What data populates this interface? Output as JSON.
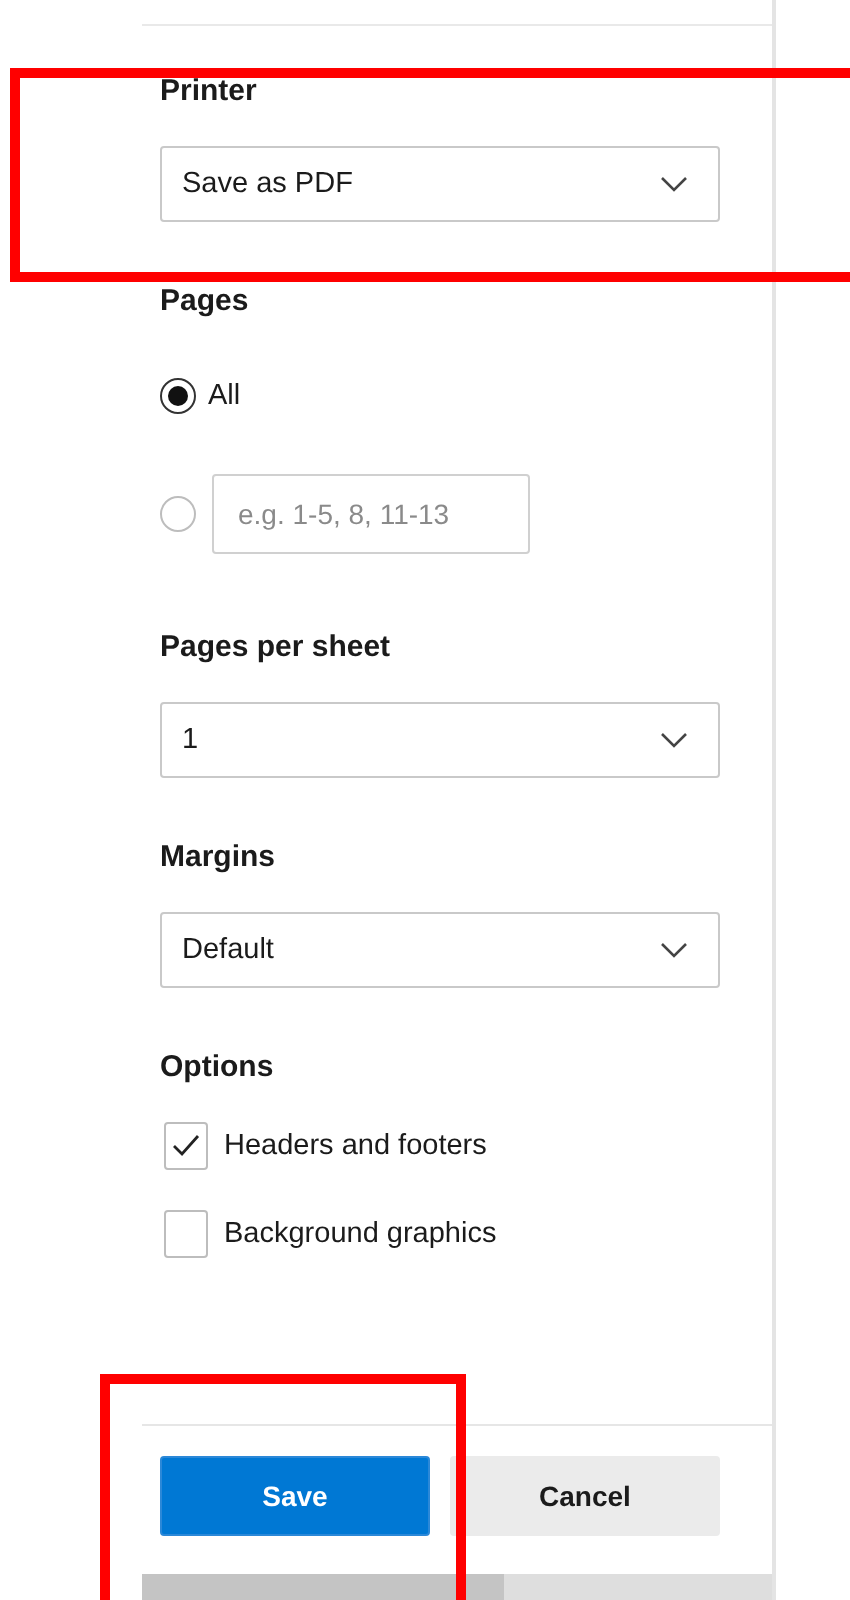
{
  "sections": [
    {
      "kind": "select",
      "title": "Printer",
      "value": "Save as PDF",
      "highlighted": true
    },
    {
      "kind": "radios",
      "title": "Pages",
      "highlighted": false,
      "options": [
        {
          "kind": "label",
          "label": "All",
          "selected": true
        },
        {
          "kind": "range",
          "placeholder": "e.g. 1-5, 8, 11-13",
          "selected": false
        }
      ]
    },
    {
      "kind": "select",
      "title": "Pages per sheet",
      "value": "1",
      "highlighted": false
    },
    {
      "kind": "select",
      "title": "Margins",
      "value": "Default",
      "highlighted": false
    },
    {
      "kind": "checks",
      "title": "Options",
      "highlighted": false,
      "items": [
        {
          "label": "Headers and footers",
          "checked": true
        },
        {
          "label": "Background graphics",
          "checked": false
        }
      ]
    }
  ],
  "actions": {
    "highlighted": true,
    "buttons": [
      {
        "kind": "primary",
        "label": "Save"
      },
      {
        "kind": "secondary",
        "label": "Cancel"
      }
    ]
  }
}
